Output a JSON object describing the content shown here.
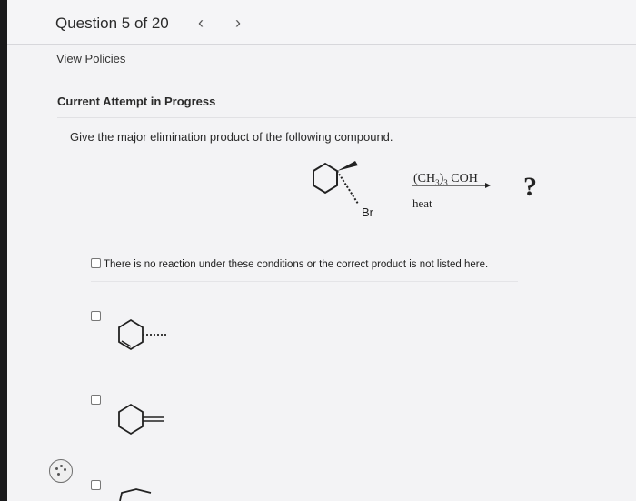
{
  "header": {
    "question_label": "Question 5 of 20",
    "prev_icon": "chevron-left-icon",
    "next_icon": "chevron-right-icon"
  },
  "view_policies": "View Policies",
  "attempt_label": "Current Attempt in Progress",
  "prompt": "Give the major elimination product of the following compound.",
  "reaction": {
    "substituent_label": "Br",
    "reagent_formula": "(CH3)3 COH",
    "condition": "heat",
    "product_placeholder": "?"
  },
  "options": [
    {
      "label": "There is no reaction under these conditions or the correct product is not listed here.",
      "checked": false
    },
    {
      "label": "",
      "structure": "cyclohexene-with-methyl",
      "checked": false
    },
    {
      "label": "",
      "structure": "methylenecyclohexane",
      "checked": false
    },
    {
      "label": "",
      "structure": "partially-visible-structure",
      "checked": false
    }
  ],
  "assist_icon": "palette-icon"
}
